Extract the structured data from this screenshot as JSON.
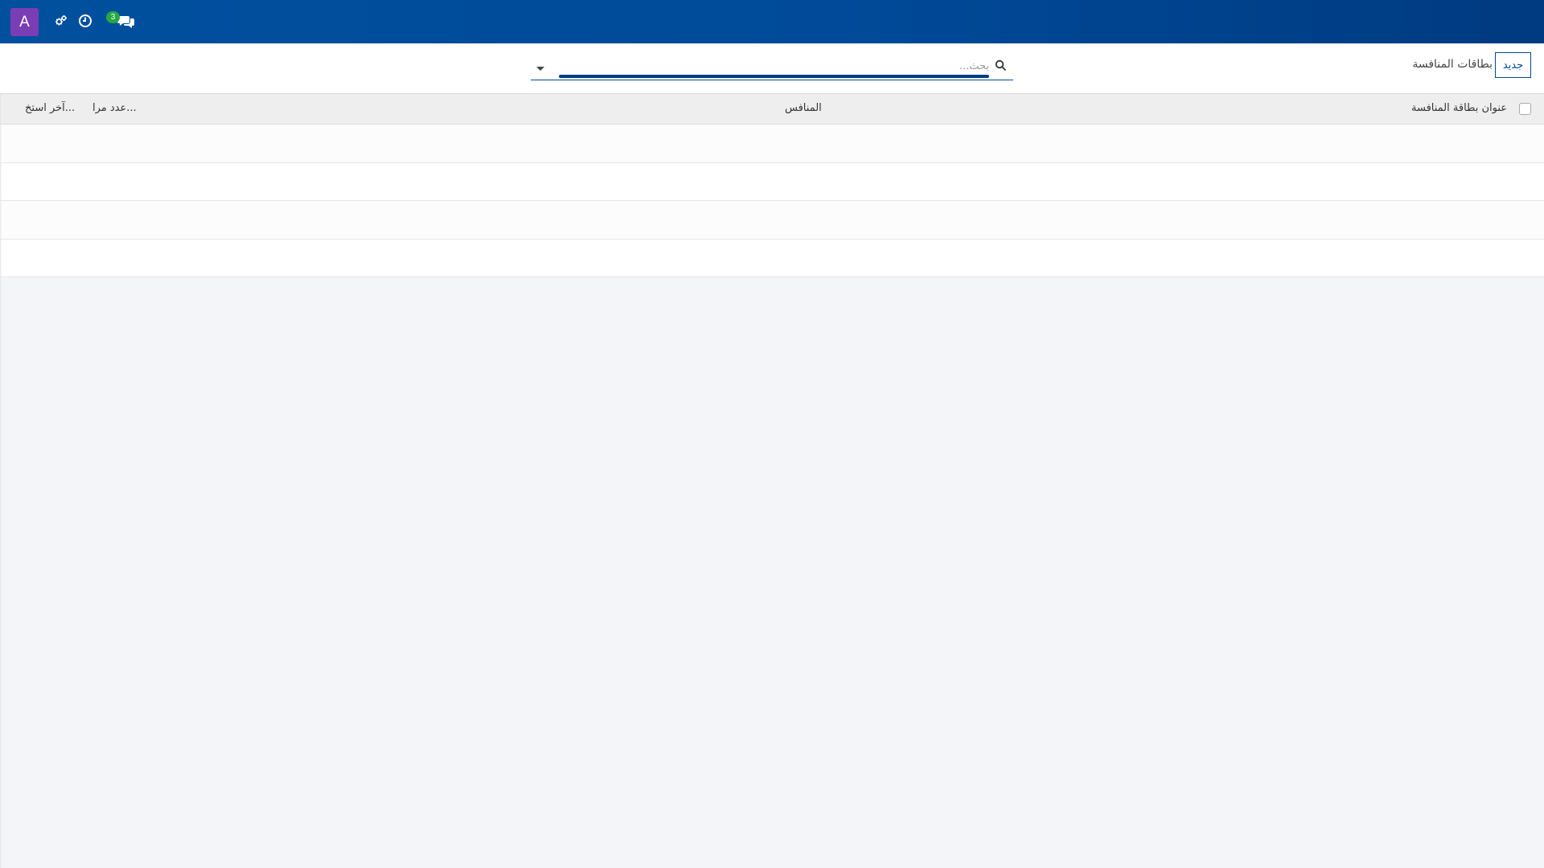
{
  "navbar": {
    "user_initial": "A",
    "chat_badge_count": "3",
    "icons": [
      "user-avatar",
      "settings-icon",
      "clock-icon",
      "chat-icon"
    ],
    "bg_color": "#004a99"
  },
  "control_panel": {
    "new_button_label": "جديد",
    "breadcrumb_title": "بطاقات المنافسة",
    "search_placeholder": "بحث..."
  },
  "table": {
    "columns": {
      "title": "عنوان بطاقة المنافسة",
      "competitor": "المنافس",
      "view_count": "عدد مرا...",
      "last_used": "آخر استخ..."
    },
    "rows": []
  },
  "colors": {
    "accent": "#004a99",
    "avatar": "#7b3db4",
    "badge": "#28a745"
  }
}
